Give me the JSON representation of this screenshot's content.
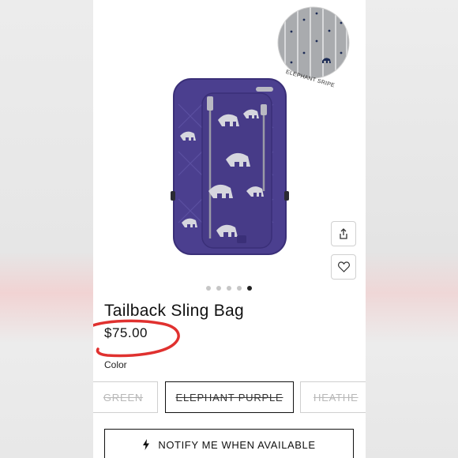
{
  "product": {
    "title": "Tailback Sling Bag",
    "price": "$75.00",
    "color_label": "Color"
  },
  "swatch": {
    "caption": "ELEPHANT SRIPE",
    "colors": {
      "bg": "#a9abae",
      "stripe": "#d8d9db",
      "dot": "#1c2b55"
    }
  },
  "carousel": {
    "count": 5,
    "active_index": 4
  },
  "actions": {
    "share_icon": "share-icon",
    "wishlist_icon": "heart-icon"
  },
  "color_options": [
    {
      "label": "GREEN",
      "selected": false
    },
    {
      "label": "ELEPHANT PURPLE",
      "selected": true
    },
    {
      "label": "HEATHE",
      "selected": false
    }
  ],
  "notify": {
    "label": "NOTIFY ME WHEN AVAILABLE",
    "icon": "lightning-icon"
  },
  "theme": {
    "bag_purple": "#4b3f8f",
    "annotation_red": "#e0312f"
  }
}
